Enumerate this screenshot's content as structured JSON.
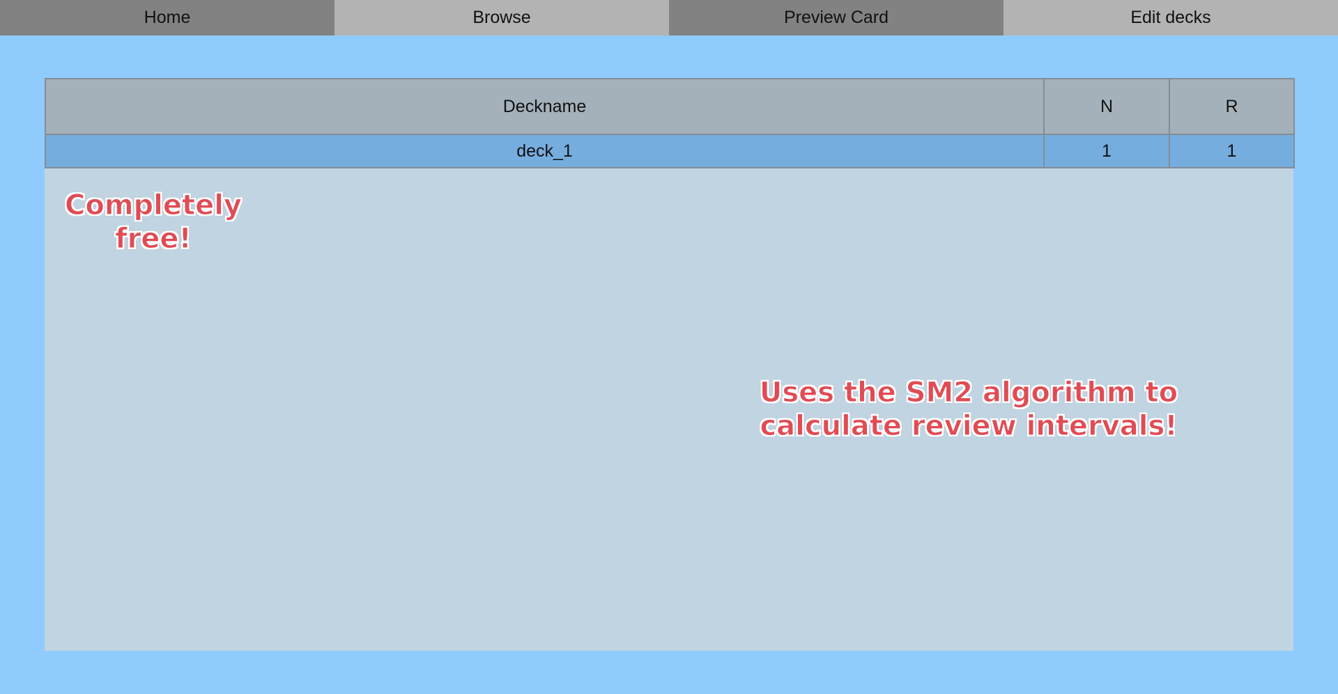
{
  "tabs": [
    {
      "label": "Home"
    },
    {
      "label": "Browse"
    },
    {
      "label": "Preview Card"
    },
    {
      "label": "Edit decks"
    }
  ],
  "deck_table": {
    "headers": {
      "name": "Deckname",
      "new": "N",
      "review": "R"
    },
    "rows": [
      {
        "name": "deck_1",
        "new": "1",
        "review": "1"
      }
    ]
  },
  "promos": {
    "free": {
      "line1": "Completely",
      "line2": "free!"
    },
    "sm2": {
      "line1": "Uses the SM2 algorithm to",
      "line2": "calculate review intervals!"
    }
  },
  "colors": {
    "background": "#90cbfd",
    "panel": "#c1d4e2",
    "header": "#a4b1bb",
    "row": "#76addf",
    "tab_dark": "#828282",
    "tab_light": "#b3b3b3",
    "promo_text": "#e14b53"
  }
}
